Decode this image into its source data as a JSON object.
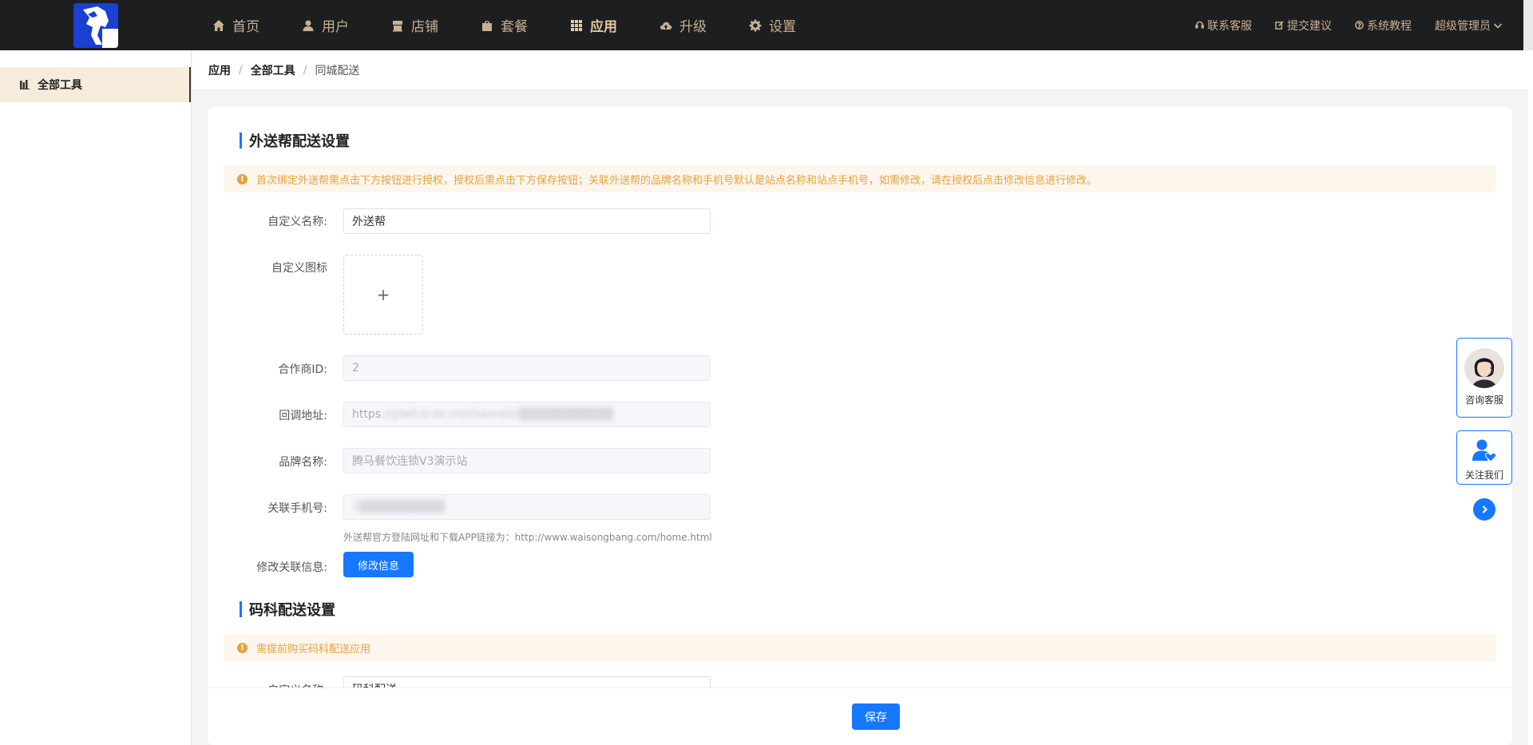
{
  "nav": {
    "items": [
      {
        "label": "首页",
        "icon": "home-icon"
      },
      {
        "label": "用户",
        "icon": "user-icon"
      },
      {
        "label": "店铺",
        "icon": "store-icon"
      },
      {
        "label": "套餐",
        "icon": "bag-icon"
      },
      {
        "label": "应用",
        "icon": "grid-icon",
        "active": true
      },
      {
        "label": "升级",
        "icon": "cloud-upload-icon"
      },
      {
        "label": "设置",
        "icon": "gear-icon"
      }
    ],
    "right": {
      "contact": "联系客服",
      "feedback": "提交建议",
      "tutorial": "系统教程",
      "admin": "超级管理员"
    }
  },
  "sidebar": {
    "items": [
      {
        "label": "全部工具"
      }
    ]
  },
  "breadcrumb": [
    "应用",
    "全部工具",
    "同城配送"
  ],
  "section1": {
    "title": "外送帮配送设置",
    "alert": "首次绑定外送帮需点击下方按钮进行授权，授权后需点击下方保存按钮；关联外送帮的品牌名称和手机号默认是站点名称和站点手机号，如需修改，请在授权后点击修改信息进行修改。",
    "fields": {
      "custom_name_label": "自定义名称:",
      "custom_name_value": "外送帮",
      "custom_icon_label": "自定义图标",
      "upload_plus": "+",
      "partner_id_label": "合作商ID:",
      "partner_id_value": "2",
      "callback_label": "回调地址:",
      "callback_prefix": "https",
      "callback_blurred": "://ylwh.b-ke.cn/channel/r▒▒▒▒▒▒▒▒▒▒▒",
      "brand_label": "品牌名称:",
      "brand_value": "腾马餐饮连锁V3演示站",
      "phone_label": "关联手机号:",
      "phone_blurred": "1▒▒▒▒▒▒▒▒▒▒",
      "hint": "外送帮官方登陆网址和下载APP链接为：http://www.waisongbang.com/home.html",
      "modify_label": "修改关联信息:",
      "modify_button": "修改信息"
    }
  },
  "section2": {
    "title": "码科配送设置",
    "alert": "需提前购买码科配送应用",
    "name_label": "自定义名称:",
    "name_value": "码科配送"
  },
  "footer": {
    "save_button": "保存"
  },
  "float": {
    "service": "咨询客服",
    "follow": "关注我们"
  },
  "colors": {
    "accent": "#1677ff",
    "nav_text": "#c8b092",
    "topbar_bg": "#1d1e20",
    "alert_text": "#e6a23c",
    "alert_bg": "#fdf6ec",
    "sidebar_active_bg": "#f7ebdc"
  }
}
